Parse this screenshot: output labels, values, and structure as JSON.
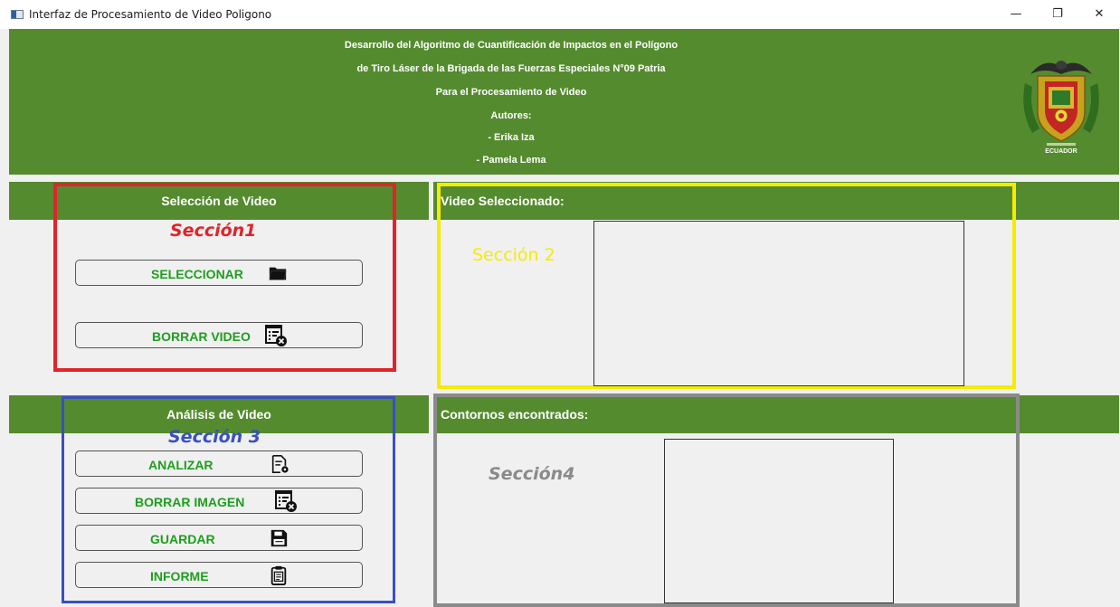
{
  "window": {
    "title": "Interfaz de Procesamiento de Video Poligono",
    "min_glyph": "—",
    "max_glyph": "❐",
    "close_glyph": "✕"
  },
  "header": {
    "line1": "Desarrollo del Algoritmo de Cuantificación de Impactos en el Polígono",
    "line2": "de Tiro Láser de la Brigada de las Fuerzas Especiales N°09 Patria",
    "line3": "Para el Procesamiento de Video",
    "line4": "Autores:",
    "line5": "- Erika Iza",
    "line6": "- Pamela Lema",
    "crest_text": "ECUADOR"
  },
  "seleccion": {
    "title": "Selección de Video",
    "section_label": "Sección1",
    "select_label": "SELECCIONAR",
    "delete_video_label": "BORRAR VIDEO"
  },
  "video": {
    "title": "Video Seleccionado:",
    "section_label": "Sección 2"
  },
  "analisis": {
    "title": "Análisis de Video",
    "section_label": "Sección 3",
    "analyze_label": "ANALIZAR",
    "delete_image_label": "BORRAR IMAGEN",
    "save_label": "GUARDAR",
    "report_label": "INFORME"
  },
  "contornos": {
    "title": "Contornos encontrados:",
    "section_label": "Sección4"
  },
  "colors": {
    "header_green": "#558b2f",
    "button_text_green": "#1e9e1e",
    "section1_red": "#e0242a",
    "section2_yellow": "#f5ec00",
    "section3_blue": "#3a4fc0",
    "section4_gray": "#8a8a8a"
  }
}
